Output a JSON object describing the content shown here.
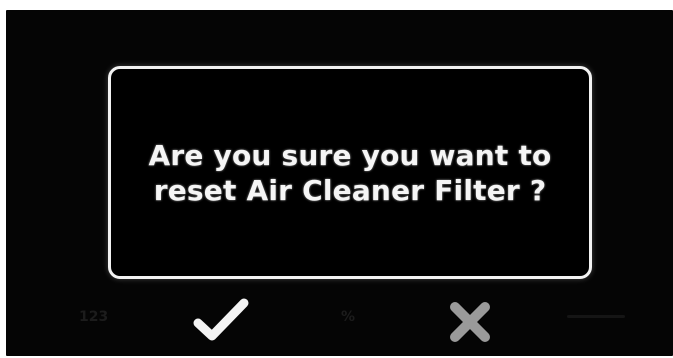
{
  "dialog": {
    "message": "Are you sure you want to\nreset Air Cleaner Filter ?"
  },
  "actions": {
    "confirm_icon": "checkmark-icon",
    "cancel_icon": "x-icon"
  },
  "softkeys": {
    "left_label": "123",
    "middle_label": "%"
  },
  "colors": {
    "background": "#050505",
    "dialog_border": "#f2f2f2",
    "text": "#f5f5f5",
    "confirm_icon": "#f4f4f4",
    "cancel_icon": "#9a9a9a"
  }
}
